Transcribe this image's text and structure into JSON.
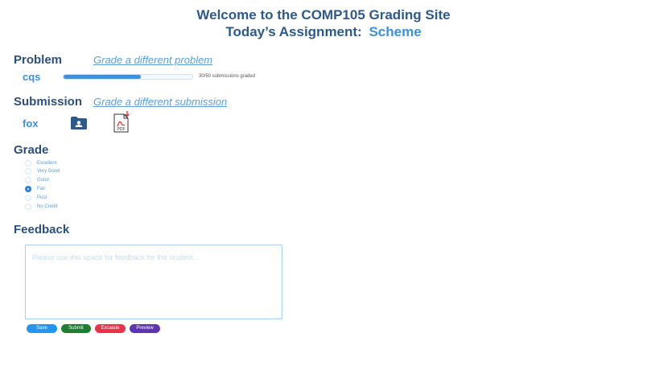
{
  "header": {
    "title": "Welcome to the COMP105 Grading Site",
    "assignment_prefix": "Today’s Assignment:",
    "assignment_name": "Scheme"
  },
  "problem": {
    "heading": "Problem",
    "change_link": "Grade a different problem",
    "name": "cqs",
    "progress_text": "30/50 submissions graded",
    "progress_fraction": 0.6
  },
  "submission": {
    "heading": "Submission",
    "change_link": "Grade a different submission",
    "student": "fox",
    "folder_icon": "user-folder-icon",
    "pdf_icon": "pdf-download-icon",
    "pdf_icon_text": "PDF"
  },
  "grade": {
    "heading": "Grade",
    "options": [
      "Excellent",
      "Very Good",
      "Good",
      "Fair",
      "Poor",
      "No Credit"
    ],
    "selected": "Fair"
  },
  "feedback": {
    "heading": "Feedback",
    "placeholder": "Please use this space for feedback for the student...",
    "value": ""
  },
  "buttons": {
    "save": "Save",
    "submit": "Submit",
    "escalate": "Escalate",
    "preview": "Preview"
  },
  "colors": {
    "heading": "#2d5a8c",
    "accent": "#3d8fe0",
    "save": "#2196f3",
    "submit": "#1e7e34",
    "escalate": "#e8334a",
    "preview": "#5e35b1"
  }
}
